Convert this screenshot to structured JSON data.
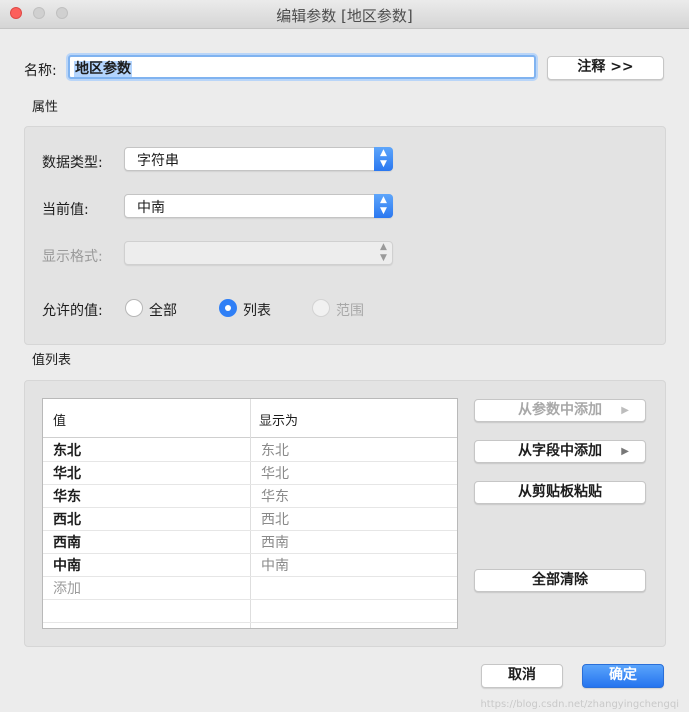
{
  "window": {
    "title": "编辑参数 [地区参数]"
  },
  "name": {
    "label": "名称:",
    "value": "地区参数"
  },
  "notes_button": "注释 >>",
  "properties": {
    "section_title": "属性",
    "data_type": {
      "label": "数据类型:",
      "value": "字符串"
    },
    "current_value": {
      "label": "当前值:",
      "value": "中南"
    },
    "display_format": {
      "label": "显示格式:",
      "value": ""
    },
    "allowed_values": {
      "label": "允许的值:",
      "options": [
        "全部",
        "列表",
        "范围"
      ],
      "selected": "列表"
    }
  },
  "value_list": {
    "section_title": "值列表",
    "columns": [
      "值",
      "显示为"
    ],
    "rows": [
      {
        "value": "东北",
        "display": "东北"
      },
      {
        "value": "华北",
        "display": "华北"
      },
      {
        "value": "华东",
        "display": "华东"
      },
      {
        "value": "西北",
        "display": "西北"
      },
      {
        "value": "西南",
        "display": "西南"
      },
      {
        "value": "中南",
        "display": "中南"
      }
    ],
    "add_placeholder": "添加",
    "buttons": {
      "add_from_parameter": "从参数中添加",
      "add_from_field": "从字段中添加",
      "paste_from_clipboard": "从剪贴板粘贴",
      "clear_all": "全部清除"
    }
  },
  "footer": {
    "cancel": "取消",
    "ok": "确定"
  },
  "watermark": "https://blog.csdn.net/zhangyingchengqi",
  "colors": {
    "accent": "#2f7ff6",
    "close_light": "#fc605c"
  }
}
